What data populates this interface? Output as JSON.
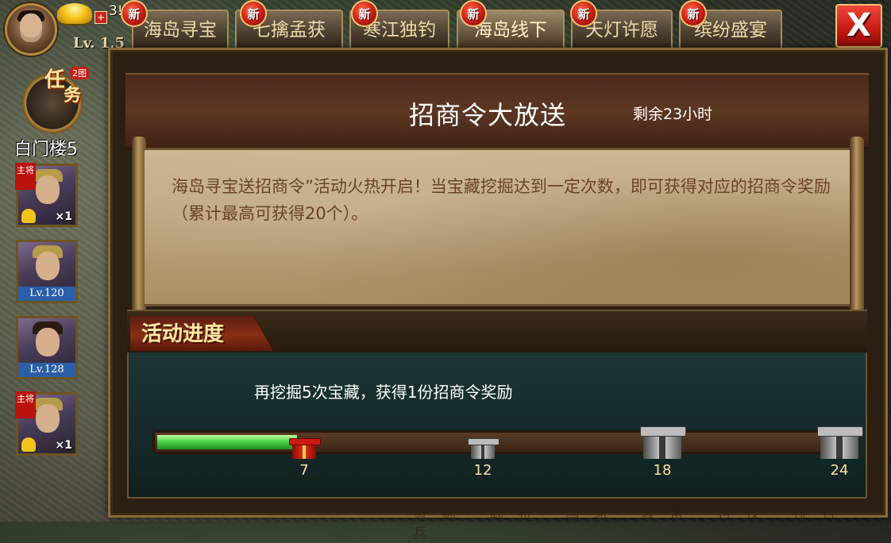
{
  "player": {
    "level_label": "Lv. 1.5",
    "coins_label": "3!",
    "plus_label": "+"
  },
  "tabs": [
    {
      "label": "海岛寻宝",
      "badge": "新",
      "active": false
    },
    {
      "label": "七擒孟获",
      "badge": "新",
      "active": false
    },
    {
      "label": "寒江独钓",
      "badge": "新",
      "active": false
    },
    {
      "label": "海岛线下",
      "badge": "新",
      "active": true
    },
    {
      "label": "天灯许愿",
      "badge": "新",
      "active": false
    },
    {
      "label": "缤纷盛宴",
      "badge": "新",
      "active": false
    }
  ],
  "close_label": "X",
  "task": {
    "title": "任",
    "sub": "务",
    "badge": "2图"
  },
  "location": "白门楼5",
  "heroes": [
    {
      "ribbon": "主将",
      "count": "×1",
      "level": ""
    },
    {
      "ribbon": "",
      "count": "",
      "level": "Lv.120"
    },
    {
      "ribbon": "",
      "count": "",
      "level": "Lv.128"
    },
    {
      "ribbon": "主将",
      "count": "×1",
      "level": ""
    }
  ],
  "panel": {
    "title": "招商令大放送",
    "time_left": "剩余23小时",
    "description": "海岛寻宝送招商令”活动火热开启！当宝藏挖掘达到一定次数，即可获得对应的招商令奖励（累计最高可获得20个）。"
  },
  "progress": {
    "section_label": "活动进度",
    "hint": "再挖掘5次宝藏，获得1份招商令奖励",
    "current": 7,
    "max": 24,
    "milestones": [
      {
        "value": "7",
        "reached": true
      },
      {
        "value": "12",
        "reached": false
      },
      {
        "value": "18",
        "reached": false
      },
      {
        "value": "24",
        "reached": false
      }
    ]
  },
  "bottom_menu": "资源 武将 国家 装备 科技 排行 兵"
}
